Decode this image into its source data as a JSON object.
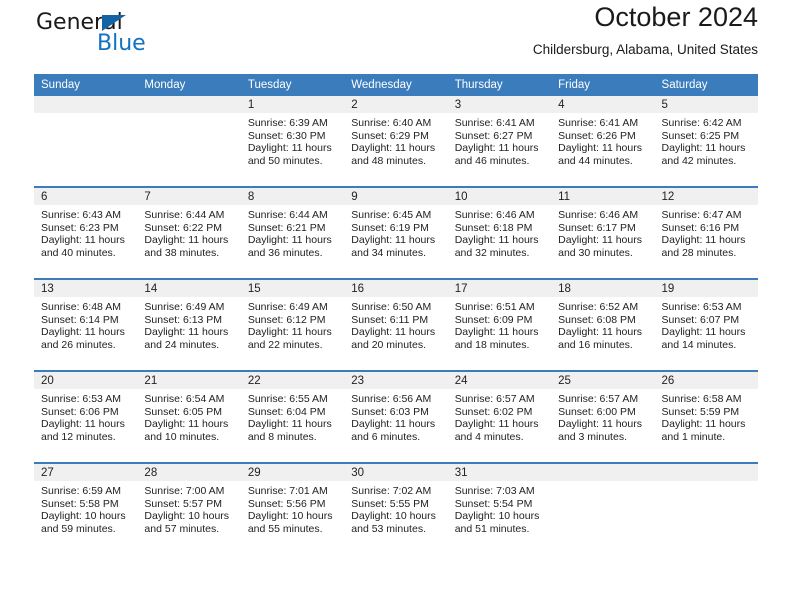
{
  "brand": {
    "name_top": "General",
    "name_bottom": "Blue",
    "accent_color": "#1072c0",
    "triangle_color": "#1464a5"
  },
  "header": {
    "title": "October 2024",
    "subtitle": "Childersburg, Alabama, United States"
  },
  "theme": {
    "header_row_bg": "#3b7cbd",
    "daynum_band_bg": "#f0f0f0",
    "row_divider": "#3b7cbd",
    "text": "#222222"
  },
  "weekday_headers": [
    "Sunday",
    "Monday",
    "Tuesday",
    "Wednesday",
    "Thursday",
    "Friday",
    "Saturday"
  ],
  "labels": {
    "sunrise_prefix": "Sunrise:",
    "sunset_prefix": "Sunset:",
    "daylight_prefix": "Daylight:"
  },
  "chart_data": {
    "type": "table",
    "title": "October 2024",
    "subtitle": "Childersburg, Alabama, United States",
    "columns": [
      "Sunday",
      "Monday",
      "Tuesday",
      "Wednesday",
      "Thursday",
      "Friday",
      "Saturday"
    ],
    "weeks": [
      [
        {
          "day": "",
          "empty": true
        },
        {
          "day": "",
          "empty": true
        },
        {
          "day": "1",
          "sunrise": "6:39 AM",
          "sunset": "6:30 PM",
          "daylight_line1": "Daylight: 11 hours",
          "daylight_line2": "and 50 minutes.",
          "daylight_hours": 11,
          "daylight_minutes": 50
        },
        {
          "day": "2",
          "sunrise": "6:40 AM",
          "sunset": "6:29 PM",
          "daylight_line1": "Daylight: 11 hours",
          "daylight_line2": "and 48 minutes.",
          "daylight_hours": 11,
          "daylight_minutes": 48
        },
        {
          "day": "3",
          "sunrise": "6:41 AM",
          "sunset": "6:27 PM",
          "daylight_line1": "Daylight: 11 hours",
          "daylight_line2": "and 46 minutes.",
          "daylight_hours": 11,
          "daylight_minutes": 46
        },
        {
          "day": "4",
          "sunrise": "6:41 AM",
          "sunset": "6:26 PM",
          "daylight_line1": "Daylight: 11 hours",
          "daylight_line2": "and 44 minutes.",
          "daylight_hours": 11,
          "daylight_minutes": 44
        },
        {
          "day": "5",
          "sunrise": "6:42 AM",
          "sunset": "6:25 PM",
          "daylight_line1": "Daylight: 11 hours",
          "daylight_line2": "and 42 minutes.",
          "daylight_hours": 11,
          "daylight_minutes": 42
        }
      ],
      [
        {
          "day": "6",
          "sunrise": "6:43 AM",
          "sunset": "6:23 PM",
          "daylight_line1": "Daylight: 11 hours",
          "daylight_line2": "and 40 minutes.",
          "daylight_hours": 11,
          "daylight_minutes": 40
        },
        {
          "day": "7",
          "sunrise": "6:44 AM",
          "sunset": "6:22 PM",
          "daylight_line1": "Daylight: 11 hours",
          "daylight_line2": "and 38 minutes.",
          "daylight_hours": 11,
          "daylight_minutes": 38
        },
        {
          "day": "8",
          "sunrise": "6:44 AM",
          "sunset": "6:21 PM",
          "daylight_line1": "Daylight: 11 hours",
          "daylight_line2": "and 36 minutes.",
          "daylight_hours": 11,
          "daylight_minutes": 36
        },
        {
          "day": "9",
          "sunrise": "6:45 AM",
          "sunset": "6:19 PM",
          "daylight_line1": "Daylight: 11 hours",
          "daylight_line2": "and 34 minutes.",
          "daylight_hours": 11,
          "daylight_minutes": 34
        },
        {
          "day": "10",
          "sunrise": "6:46 AM",
          "sunset": "6:18 PM",
          "daylight_line1": "Daylight: 11 hours",
          "daylight_line2": "and 32 minutes.",
          "daylight_hours": 11,
          "daylight_minutes": 32
        },
        {
          "day": "11",
          "sunrise": "6:46 AM",
          "sunset": "6:17 PM",
          "daylight_line1": "Daylight: 11 hours",
          "daylight_line2": "and 30 minutes.",
          "daylight_hours": 11,
          "daylight_minutes": 30
        },
        {
          "day": "12",
          "sunrise": "6:47 AM",
          "sunset": "6:16 PM",
          "daylight_line1": "Daylight: 11 hours",
          "daylight_line2": "and 28 minutes.",
          "daylight_hours": 11,
          "daylight_minutes": 28
        }
      ],
      [
        {
          "day": "13",
          "sunrise": "6:48 AM",
          "sunset": "6:14 PM",
          "daylight_line1": "Daylight: 11 hours",
          "daylight_line2": "and 26 minutes.",
          "daylight_hours": 11,
          "daylight_minutes": 26
        },
        {
          "day": "14",
          "sunrise": "6:49 AM",
          "sunset": "6:13 PM",
          "daylight_line1": "Daylight: 11 hours",
          "daylight_line2": "and 24 minutes.",
          "daylight_hours": 11,
          "daylight_minutes": 24
        },
        {
          "day": "15",
          "sunrise": "6:49 AM",
          "sunset": "6:12 PM",
          "daylight_line1": "Daylight: 11 hours",
          "daylight_line2": "and 22 minutes.",
          "daylight_hours": 11,
          "daylight_minutes": 22
        },
        {
          "day": "16",
          "sunrise": "6:50 AM",
          "sunset": "6:11 PM",
          "daylight_line1": "Daylight: 11 hours",
          "daylight_line2": "and 20 minutes.",
          "daylight_hours": 11,
          "daylight_minutes": 20
        },
        {
          "day": "17",
          "sunrise": "6:51 AM",
          "sunset": "6:09 PM",
          "daylight_line1": "Daylight: 11 hours",
          "daylight_line2": "and 18 minutes.",
          "daylight_hours": 11,
          "daylight_minutes": 18
        },
        {
          "day": "18",
          "sunrise": "6:52 AM",
          "sunset": "6:08 PM",
          "daylight_line1": "Daylight: 11 hours",
          "daylight_line2": "and 16 minutes.",
          "daylight_hours": 11,
          "daylight_minutes": 16
        },
        {
          "day": "19",
          "sunrise": "6:53 AM",
          "sunset": "6:07 PM",
          "daylight_line1": "Daylight: 11 hours",
          "daylight_line2": "and 14 minutes.",
          "daylight_hours": 11,
          "daylight_minutes": 14
        }
      ],
      [
        {
          "day": "20",
          "sunrise": "6:53 AM",
          "sunset": "6:06 PM",
          "daylight_line1": "Daylight: 11 hours",
          "daylight_line2": "and 12 minutes.",
          "daylight_hours": 11,
          "daylight_minutes": 12
        },
        {
          "day": "21",
          "sunrise": "6:54 AM",
          "sunset": "6:05 PM",
          "daylight_line1": "Daylight: 11 hours",
          "daylight_line2": "and 10 minutes.",
          "daylight_hours": 11,
          "daylight_minutes": 10
        },
        {
          "day": "22",
          "sunrise": "6:55 AM",
          "sunset": "6:04 PM",
          "daylight_line1": "Daylight: 11 hours",
          "daylight_line2": "and 8 minutes.",
          "daylight_hours": 11,
          "daylight_minutes": 8
        },
        {
          "day": "23",
          "sunrise": "6:56 AM",
          "sunset": "6:03 PM",
          "daylight_line1": "Daylight: 11 hours",
          "daylight_line2": "and 6 minutes.",
          "daylight_hours": 11,
          "daylight_minutes": 6
        },
        {
          "day": "24",
          "sunrise": "6:57 AM",
          "sunset": "6:02 PM",
          "daylight_line1": "Daylight: 11 hours",
          "daylight_line2": "and 4 minutes.",
          "daylight_hours": 11,
          "daylight_minutes": 4
        },
        {
          "day": "25",
          "sunrise": "6:57 AM",
          "sunset": "6:00 PM",
          "daylight_line1": "Daylight: 11 hours",
          "daylight_line2": "and 3 minutes.",
          "daylight_hours": 11,
          "daylight_minutes": 3
        },
        {
          "day": "26",
          "sunrise": "6:58 AM",
          "sunset": "5:59 PM",
          "daylight_line1": "Daylight: 11 hours",
          "daylight_line2": "and 1 minute.",
          "daylight_hours": 11,
          "daylight_minutes": 1
        }
      ],
      [
        {
          "day": "27",
          "sunrise": "6:59 AM",
          "sunset": "5:58 PM",
          "daylight_line1": "Daylight: 10 hours",
          "daylight_line2": "and 59 minutes.",
          "daylight_hours": 10,
          "daylight_minutes": 59
        },
        {
          "day": "28",
          "sunrise": "7:00 AM",
          "sunset": "5:57 PM",
          "daylight_line1": "Daylight: 10 hours",
          "daylight_line2": "and 57 minutes.",
          "daylight_hours": 10,
          "daylight_minutes": 57
        },
        {
          "day": "29",
          "sunrise": "7:01 AM",
          "sunset": "5:56 PM",
          "daylight_line1": "Daylight: 10 hours",
          "daylight_line2": "and 55 minutes.",
          "daylight_hours": 10,
          "daylight_minutes": 55
        },
        {
          "day": "30",
          "sunrise": "7:02 AM",
          "sunset": "5:55 PM",
          "daylight_line1": "Daylight: 10 hours",
          "daylight_line2": "and 53 minutes.",
          "daylight_hours": 10,
          "daylight_minutes": 53
        },
        {
          "day": "31",
          "sunrise": "7:03 AM",
          "sunset": "5:54 PM",
          "daylight_line1": "Daylight: 10 hours",
          "daylight_line2": "and 51 minutes.",
          "daylight_hours": 10,
          "daylight_minutes": 51
        },
        {
          "day": "",
          "empty": true
        },
        {
          "day": "",
          "empty": true
        }
      ]
    ]
  }
}
